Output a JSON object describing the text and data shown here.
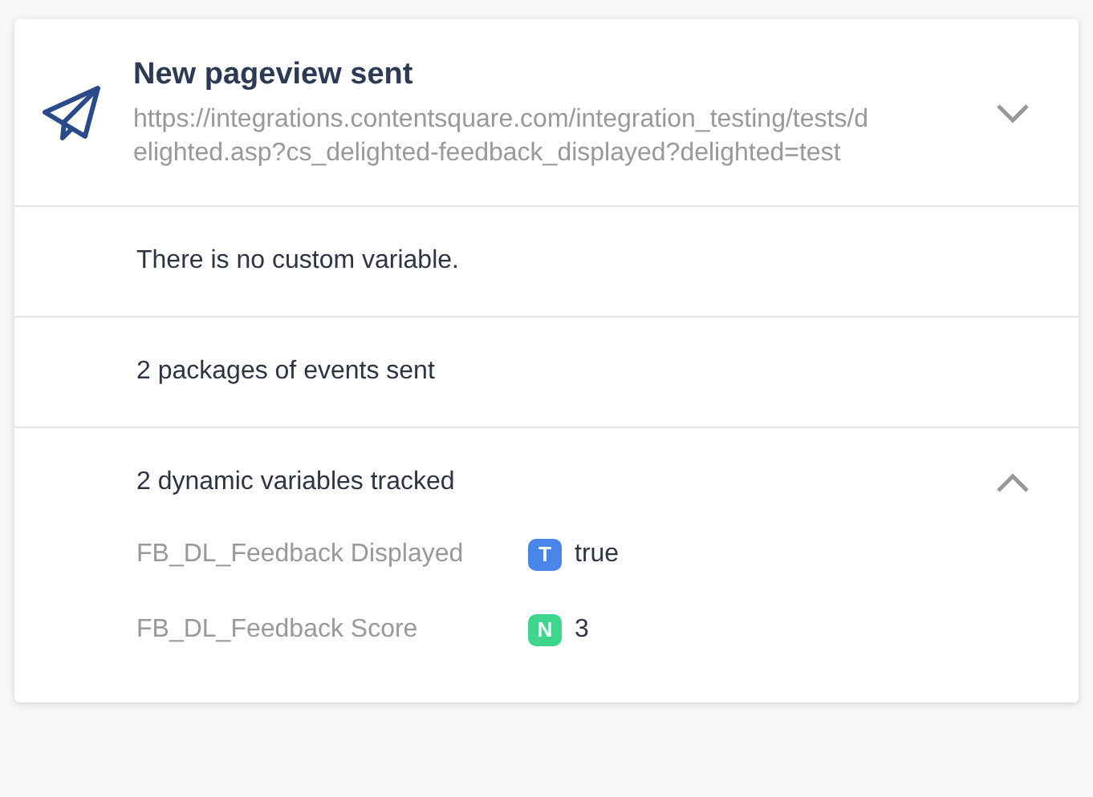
{
  "event": {
    "title": "New pageview sent",
    "url": "https://integrations.contentsquare.com/integration_testing/tests/delighted.asp?cs_delighted-feedback_displayed?delighted=test",
    "expanded": false
  },
  "rows": [
    "There is no custom variable.",
    "2 packages of events sent"
  ],
  "dynamic": {
    "title": "2 dynamic variables tracked",
    "expanded": true,
    "variables": [
      {
        "name": "FB_DL_Feedback Displayed",
        "type": "T",
        "color": "#4a86e8",
        "value": "true"
      },
      {
        "name": "FB_DL_Feedback Score",
        "type": "N",
        "color": "#3dd68c",
        "value": "3"
      }
    ]
  }
}
